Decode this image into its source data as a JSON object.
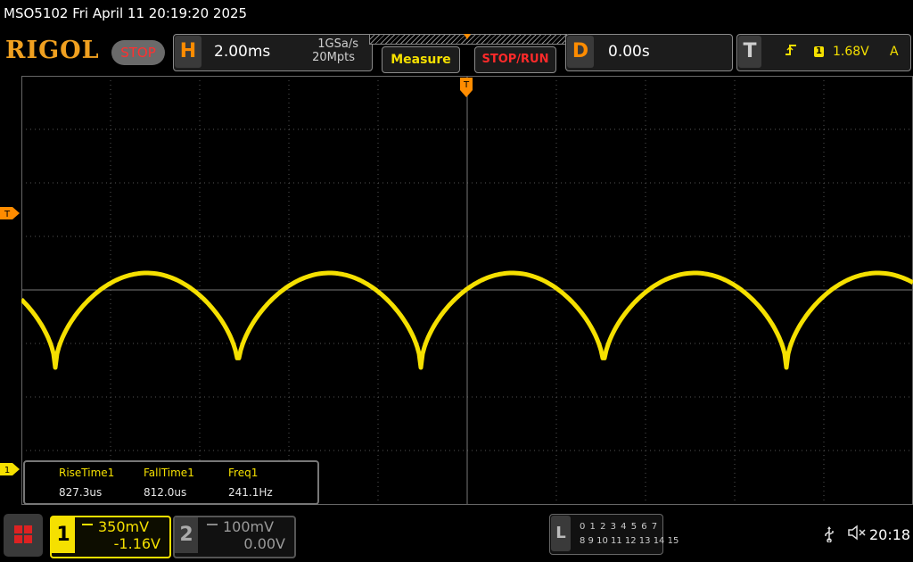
{
  "title_bar": {
    "text": "MSO5102  Fri April 11 20:19:20 2025"
  },
  "brand": {
    "logo": "RIGOL",
    "run_state": "STOP"
  },
  "horizontal": {
    "letter": "H",
    "timebase": "2.00ms",
    "sample_rate": "1GSa/s",
    "memory_depth": "20Mpts"
  },
  "toolbar": {
    "measure_label": "Measure",
    "stoprun_label": "STOP/RUN"
  },
  "delay": {
    "letter": "D",
    "value": "0.00s"
  },
  "trigger": {
    "letter": "T",
    "edge_icon": "rising-edge-icon",
    "channel": "1",
    "level": "1.68V",
    "mode": "A"
  },
  "markers": {
    "trigger_top": "T",
    "trigger_level": "T",
    "ch1_ground": "1"
  },
  "measurements": {
    "items": [
      {
        "label": "RiseTime1",
        "value": "827.3us"
      },
      {
        "label": "FallTime1",
        "value": "812.0us"
      },
      {
        "label": "Freq1",
        "value": "241.1Hz"
      }
    ]
  },
  "channels": {
    "ch1": {
      "number": "1",
      "scale": "350mV",
      "offset": "-1.16V"
    },
    "ch2": {
      "number": "2",
      "scale": "100mV",
      "offset": "0.00V"
    }
  },
  "logic": {
    "letter": "L",
    "row1": "0 1 2 3  4 5 6 7",
    "row2": "8  9 10 11  12 13 14 15"
  },
  "status": {
    "usb_icon": "usb-icon",
    "mute_icon": "speaker-muted-icon",
    "time": "20:18"
  },
  "colors": {
    "ch1": "#f5e000",
    "accent": "#ff8c00",
    "stop": "#ff2a2a"
  }
}
